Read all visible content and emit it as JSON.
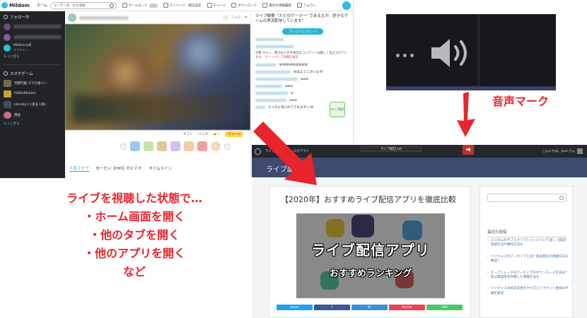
{
  "mildom": {
    "logo": "Mildom",
    "nav_home": "ホーム",
    "search_placeholder": "ユーザー名／IDを検索",
    "top_items": [
      "ゲームモード",
      "ライベージ・配信設定",
      "チャージ",
      "ダウンロード",
      "最近の視聴履歴",
      "フォロー"
    ],
    "sidebar": {
      "follow_section": "フォロー中",
      "channel_name": "Mildom公式",
      "channel_status": "オフライン",
      "more1": "もっと見る",
      "games_section": "スマホゲーム",
      "games": [
        "荒野行動-スマホ版バー",
        "PUBG(Mobile)",
        "Identity V (第五人格)",
        "雑談"
      ],
      "more2": "もっと見る"
    },
    "video_follow": "フォロー 中",
    "gift_bar": {
      "gift": "ギフト",
      "bag": "バッグ",
      "coins": "9",
      "charge": "チャージ"
    },
    "tabs": [
      "人気ライブ",
      "ゆーだい【HIH】のビデオ",
      "タイムライン"
    ],
    "chat": {
      "header": "ライブ概要: \"ただのゲーマー\" である主が、好きなゲームの実況配信しています！",
      "premium": "プレミアムコメント",
      "messages": [
        "WWWWWWWWW",
        "おはようございます!",
        "www",
        "www",
        "w",
        "www",
        "ちっちゃ見られてて気まずい W"
      ],
      "warning": "決算 ガルノ、暴力などの不適切なコンテンツは厳しく禁止されています。",
      "warning_link": "クリックして詳細を表示"
    },
    "badge": "ライブ配信"
  },
  "volume_label": "音声マーク",
  "blog": {
    "admin_items": [
      "ライブ",
      "新規",
      "ログアウト"
    ],
    "live_tab": "ライブ配信.txt",
    "admin_user": "こんにちは、Jose さん",
    "header_title": "ライブ配信",
    "article_title": "【2020年】おすすめライブ配信アプリを徹底比較",
    "hero_big": "ライブ配信アプリ",
    "hero_small": "おすすめランキング",
    "share": [
      "tweet",
      "f",
      "B!",
      "Pocket",
      "LINE"
    ],
    "recent_heading": "最近の投稿",
    "recent_posts": [
      "ミルダムのサブスクリプションについて詳しく解説！登録方法や解除方法も",
      "ツイキャスのアーカイブとは？過去配信の視聴方法も解説！",
      "オープンレックのアーカイブのダウンロード方法は？非公開設定を利用した視聴方法も",
      "ツイキャスの名前変更のやり方とアカウント削除の手順を解説"
    ]
  },
  "caption": {
    "line1": "ライブを視聴した状態で…",
    "line2": "・ホーム画面を開く",
    "line3": "・他のタブを開く",
    "line4": "・他のアプリを開く",
    "line5": "など"
  },
  "colors": {
    "accent_red": "#e8242c",
    "mildom_teal": "#1fc6d7",
    "blog_header": "#3e4a6f"
  }
}
